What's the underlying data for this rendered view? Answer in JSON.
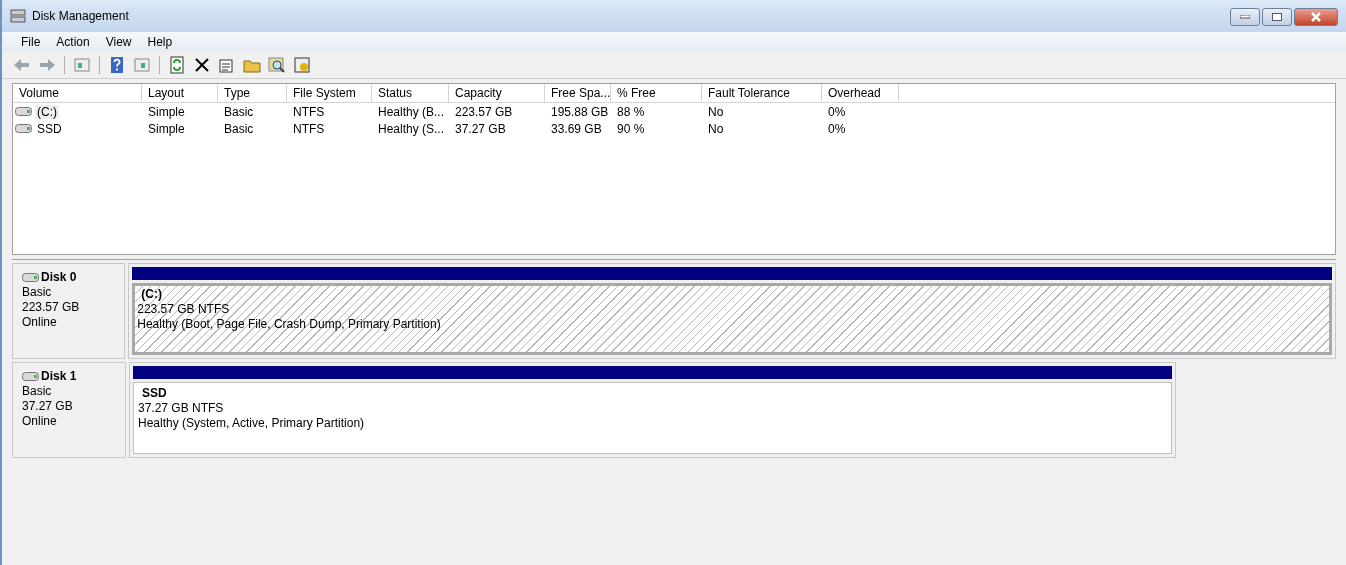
{
  "window": {
    "title": "Disk Management"
  },
  "menu": [
    "File",
    "Action",
    "View",
    "Help"
  ],
  "table": {
    "columns": [
      "Volume",
      "Layout",
      "Type",
      "File System",
      "Status",
      "Capacity",
      "Free Spa...",
      "% Free",
      "Fault Tolerance",
      "Overhead"
    ],
    "rows": [
      {
        "selected": true,
        "cells": [
          "(C:)",
          "Simple",
          "Basic",
          "NTFS",
          "Healthy (B...",
          "223.57 GB",
          "195.88 GB",
          "88 %",
          "No",
          "0%"
        ]
      },
      {
        "selected": false,
        "cells": [
          "SSD",
          "Simple",
          "Basic",
          "NTFS",
          "Healthy (S...",
          "37.27 GB",
          "33.69 GB",
          "90 %",
          "No",
          "0%"
        ]
      }
    ]
  },
  "disks": [
    {
      "name": "Disk 0",
      "type": "Basic",
      "size": "223.57 GB",
      "status": "Online",
      "partition": {
        "name": "(C:)",
        "size": "223.57 GB NTFS",
        "status": "Healthy (Boot, Page File, Crash Dump, Primary Partition)",
        "selected": true
      }
    },
    {
      "name": "Disk 1",
      "type": "Basic",
      "size": "37.27 GB",
      "status": "Online",
      "partition": {
        "name": "SSD",
        "size": "37.27 GB NTFS",
        "status": "Healthy (System, Active, Primary Partition)",
        "selected": false
      }
    }
  ]
}
